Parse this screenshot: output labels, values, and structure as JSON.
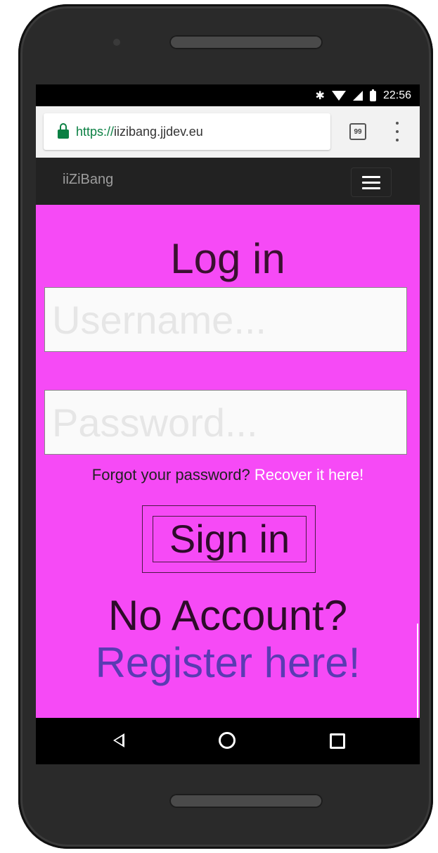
{
  "status_bar": {
    "time": "22:56",
    "icons": [
      "bluetooth-icon",
      "wifi-icon",
      "signal-icon",
      "battery-icon"
    ]
  },
  "browser": {
    "url_scheme": "https://",
    "url_host": "iizibang.jjdev.eu",
    "tabs_count": "99"
  },
  "navbar": {
    "brand": "iiZiBang"
  },
  "login": {
    "title": "Log in",
    "username_placeholder": "Username...",
    "password_placeholder": "Password...",
    "forgot_text": "Forgot your password?",
    "recover_link": "Recover it here!",
    "signin_label": "Sign in",
    "no_account": "No Account?",
    "register_link": "Register here!"
  },
  "colors": {
    "page_bg": "#f64af6",
    "navbar_bg": "#222222",
    "register_link": "#5b3bb3",
    "secure_green": "#0b8043"
  }
}
